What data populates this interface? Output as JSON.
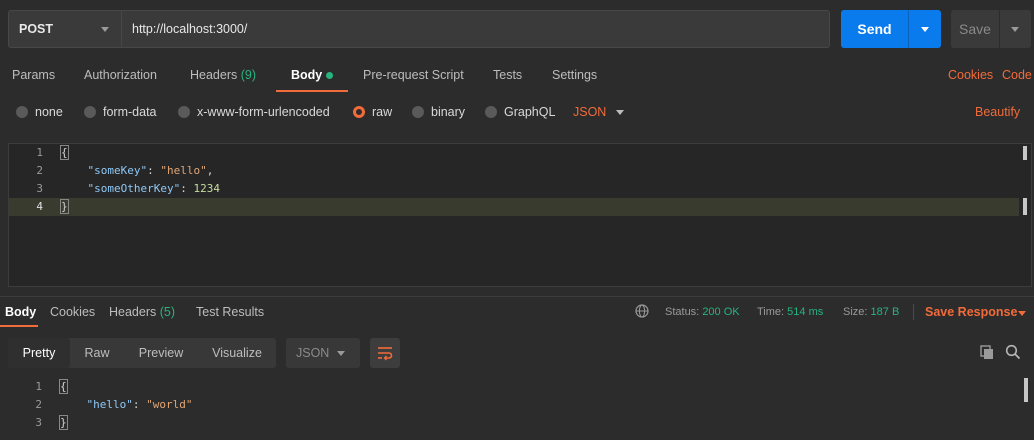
{
  "request": {
    "method": "POST",
    "url": "http://localhost:3000/",
    "send_label": "Send",
    "save_label": "Save"
  },
  "request_tabs": {
    "params": "Params",
    "authorization": "Authorization",
    "headers": "Headers",
    "headers_count": "(9)",
    "body": "Body",
    "prerequest": "Pre-request Script",
    "tests": "Tests",
    "settings": "Settings",
    "cookies": "Cookies",
    "code": "Code"
  },
  "body_types": {
    "none": "none",
    "form_data": "form-data",
    "urlencoded": "x-www-form-urlencoded",
    "raw": "raw",
    "binary": "binary",
    "graphql": "GraphQL",
    "selected": "raw",
    "language": "JSON",
    "beautify": "Beautify"
  },
  "request_body": {
    "line_numbers": [
      "1",
      "2",
      "3",
      "4"
    ],
    "open_brace": "{",
    "close_brace": "}",
    "key1": "\"someKey\"",
    "val1": "\"hello\"",
    "key2": "\"someOtherKey\"",
    "val2": "1234"
  },
  "response_tabs": {
    "body": "Body",
    "cookies": "Cookies",
    "headers": "Headers",
    "headers_count": "(5)",
    "test_results": "Test Results"
  },
  "response_status": {
    "status_label": "Status:",
    "status_value": "200 OK",
    "time_label": "Time:",
    "time_value": "514 ms",
    "size_label": "Size:",
    "size_value": "187 B",
    "save_response": "Save Response"
  },
  "response_toolbar": {
    "pretty": "Pretty",
    "raw": "Raw",
    "preview": "Preview",
    "visualize": "Visualize",
    "format": "JSON"
  },
  "response_body": {
    "line_numbers": [
      "1",
      "2",
      "3"
    ],
    "open_brace": "{",
    "close_brace": "}",
    "key1": "\"hello\"",
    "val1": "\"world\""
  },
  "colors": {
    "accent": "#f26b3a",
    "primary": "#097bed",
    "success": "#26b47f",
    "background": "#2c2c2c"
  }
}
